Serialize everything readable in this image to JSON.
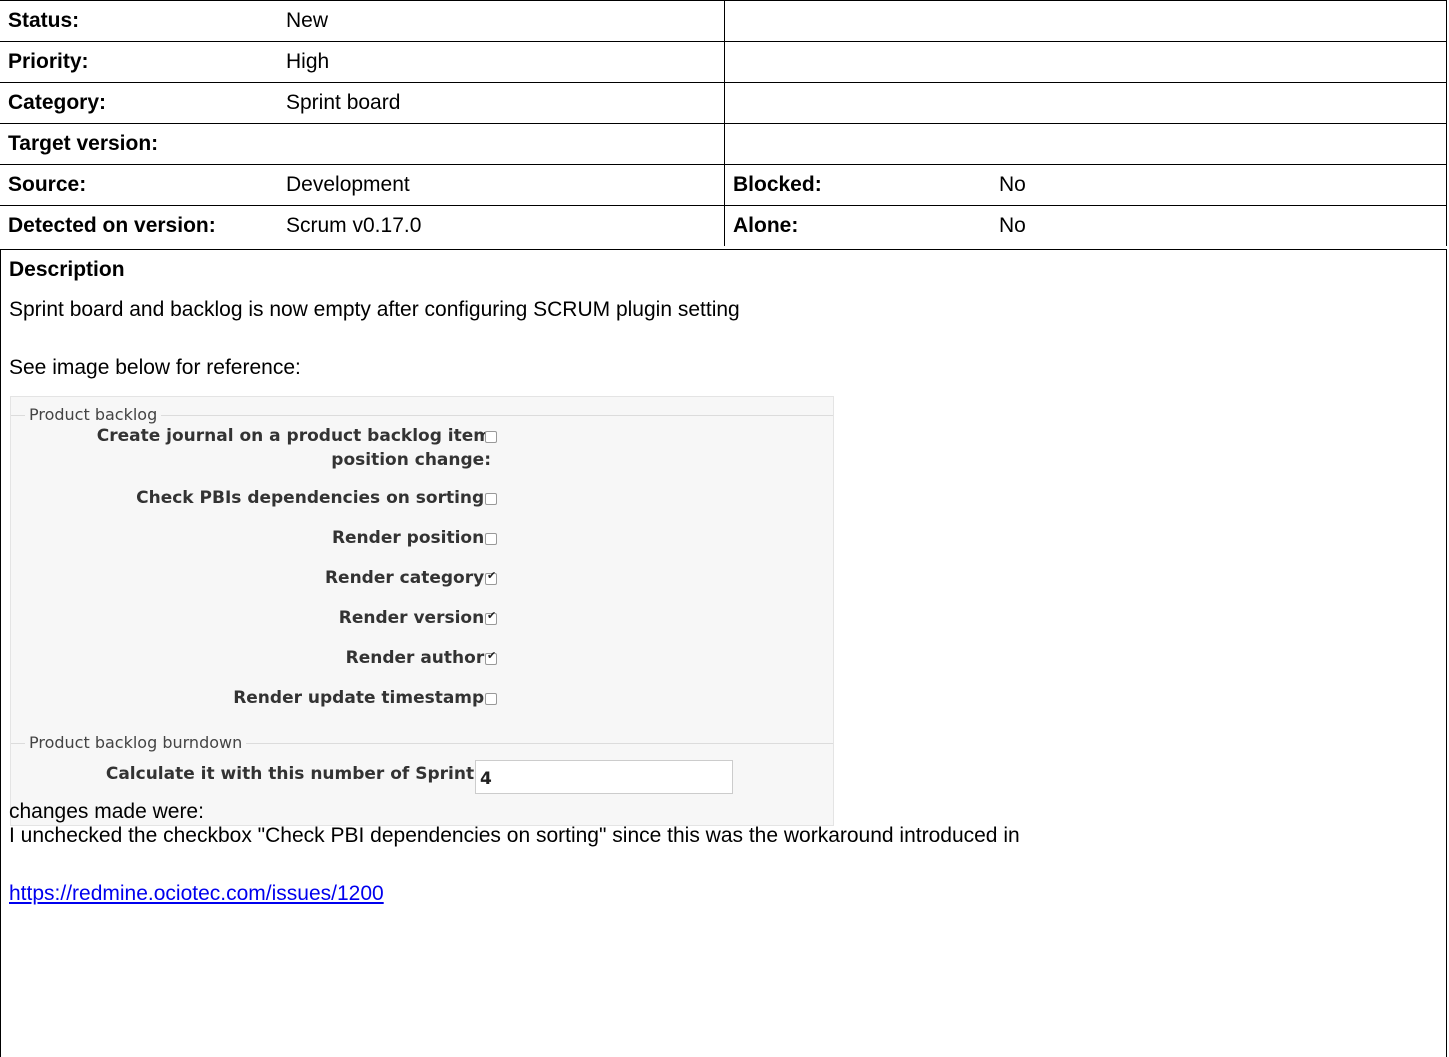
{
  "attributes": {
    "status_label": "Status:",
    "status_value": "New",
    "priority_label": "Priority:",
    "priority_value": "High",
    "category_label": "Category:",
    "category_value": "Sprint board",
    "target_label": "Target version:",
    "target_value": "",
    "source_label": "Source:",
    "source_value": "Development",
    "blocked_label": "Blocked:",
    "blocked_value": "No",
    "detected_label": "Detected on version:",
    "detected_value": "Scrum v0.17.0",
    "alone_label": "Alone:",
    "alone_value": "No"
  },
  "description": {
    "title": "Description",
    "line1": "Sprint board and backlog is now empty after configuring SCRUM plugin setting",
    "line2": "See image below for reference:",
    "line3": "changes made were:",
    "line4": "I unchecked the checkbox \"Check PBI dependencies on sorting\" since this was the workaround introduced in",
    "link": "https://redmine.ociotec.com/issues/1200"
  },
  "screenshot": {
    "section1_legend": "Product backlog",
    "rows": [
      {
        "label": "Create journal on a product backlog item",
        "checked": false
      },
      {
        "label": "position change:"
      },
      {
        "label": "Check PBIs dependencies on sorting:",
        "checked": false
      },
      {
        "label": "Render position:",
        "checked": false
      },
      {
        "label": "Render category:",
        "checked": true
      },
      {
        "label": "Render version:",
        "checked": true
      },
      {
        "label": "Render author:",
        "checked": true
      },
      {
        "label": "Render update timestamp:",
        "checked": false
      }
    ],
    "section2_legend": "Product backlog burndown",
    "sprints_label": "Calculate it with this number of Sprints:",
    "sprints_value": "4"
  }
}
